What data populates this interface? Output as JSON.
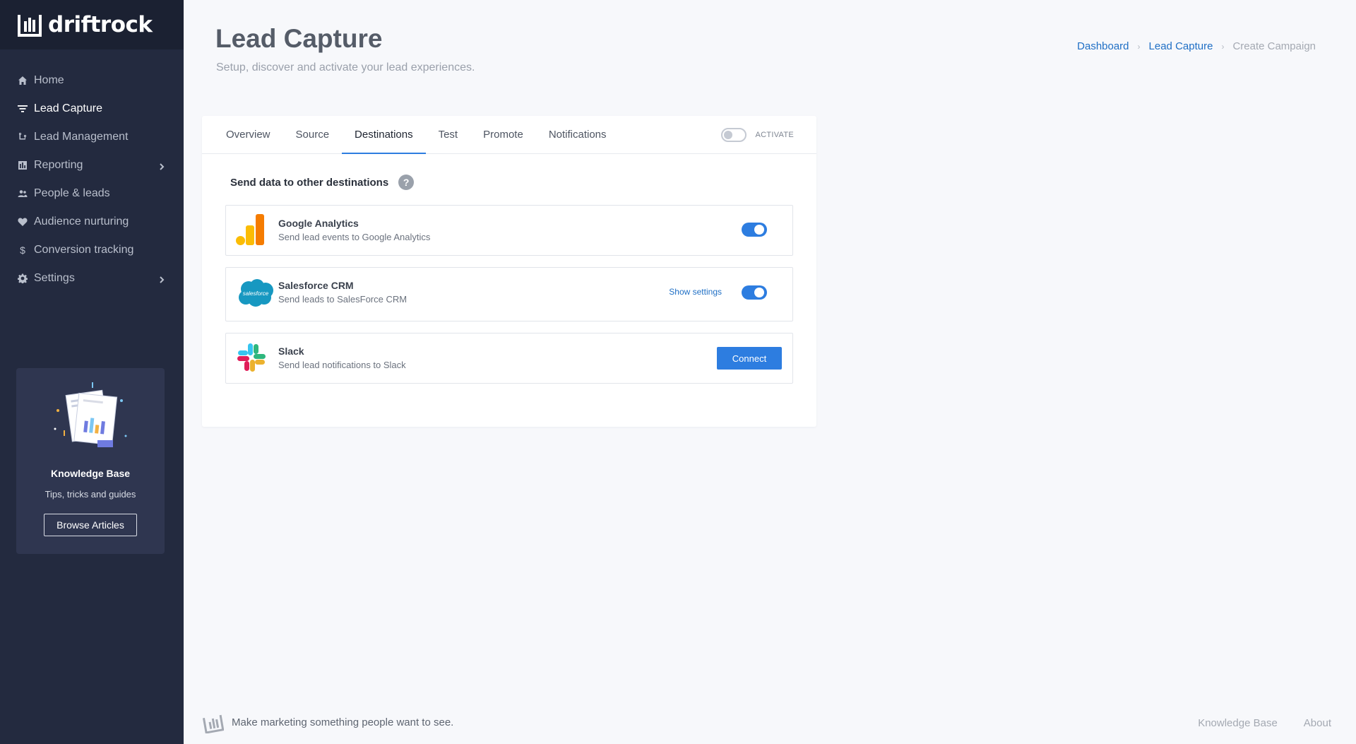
{
  "app": {
    "logo_text": "driftrock"
  },
  "sidebar": {
    "items": [
      {
        "label": "Home",
        "icon": "home-icon"
      },
      {
        "label": "Lead Capture",
        "icon": "filter-icon",
        "active": true
      },
      {
        "label": "Lead Management",
        "icon": "workflow-icon"
      },
      {
        "label": "Reporting",
        "icon": "chart-icon",
        "has_submenu": true
      },
      {
        "label": "People & leads",
        "icon": "people-icon"
      },
      {
        "label": "Audience nurturing",
        "icon": "heart-icon"
      },
      {
        "label": "Conversion tracking",
        "icon": "dollar-icon"
      },
      {
        "label": "Settings",
        "icon": "gear-icon",
        "has_submenu": true
      }
    ],
    "knowledge_base": {
      "title": "Knowledge Base",
      "subtitle": "Tips, tricks and guides",
      "button": "Browse Articles"
    }
  },
  "header": {
    "title": "Lead Capture",
    "subtitle": "Setup, discover and activate your lead experiences.",
    "breadcrumb": {
      "items": [
        "Dashboard",
        "Lead Capture"
      ],
      "current": "Create Campaign",
      "separator": "›"
    }
  },
  "tabs": {
    "items": [
      "Overview",
      "Source",
      "Destinations",
      "Test",
      "Promote",
      "Notifications"
    ],
    "active": "Destinations",
    "activate_label": "ACTIVATE",
    "activate_on": false
  },
  "destinations": {
    "title": "Send data to other destinations",
    "help": "?",
    "items": [
      {
        "name": "Google Analytics",
        "description": "Send lead events to Google Analytics",
        "enabled": true
      },
      {
        "name": "Salesforce CRM",
        "description": "Send leads to SalesForce CRM",
        "settings_link": "Show settings",
        "enabled": true,
        "logo_text": "salesforce"
      },
      {
        "name": "Slack",
        "description": "Send lead notifications to Slack",
        "action": "Connect"
      }
    ]
  },
  "footer": {
    "tagline": "Make marketing something people want to see.",
    "links": [
      "Knowledge Base",
      "About"
    ]
  },
  "colors": {
    "sidebar_bg": "#232a3f",
    "accent": "#2d7de0",
    "link": "#1f6fc5"
  }
}
